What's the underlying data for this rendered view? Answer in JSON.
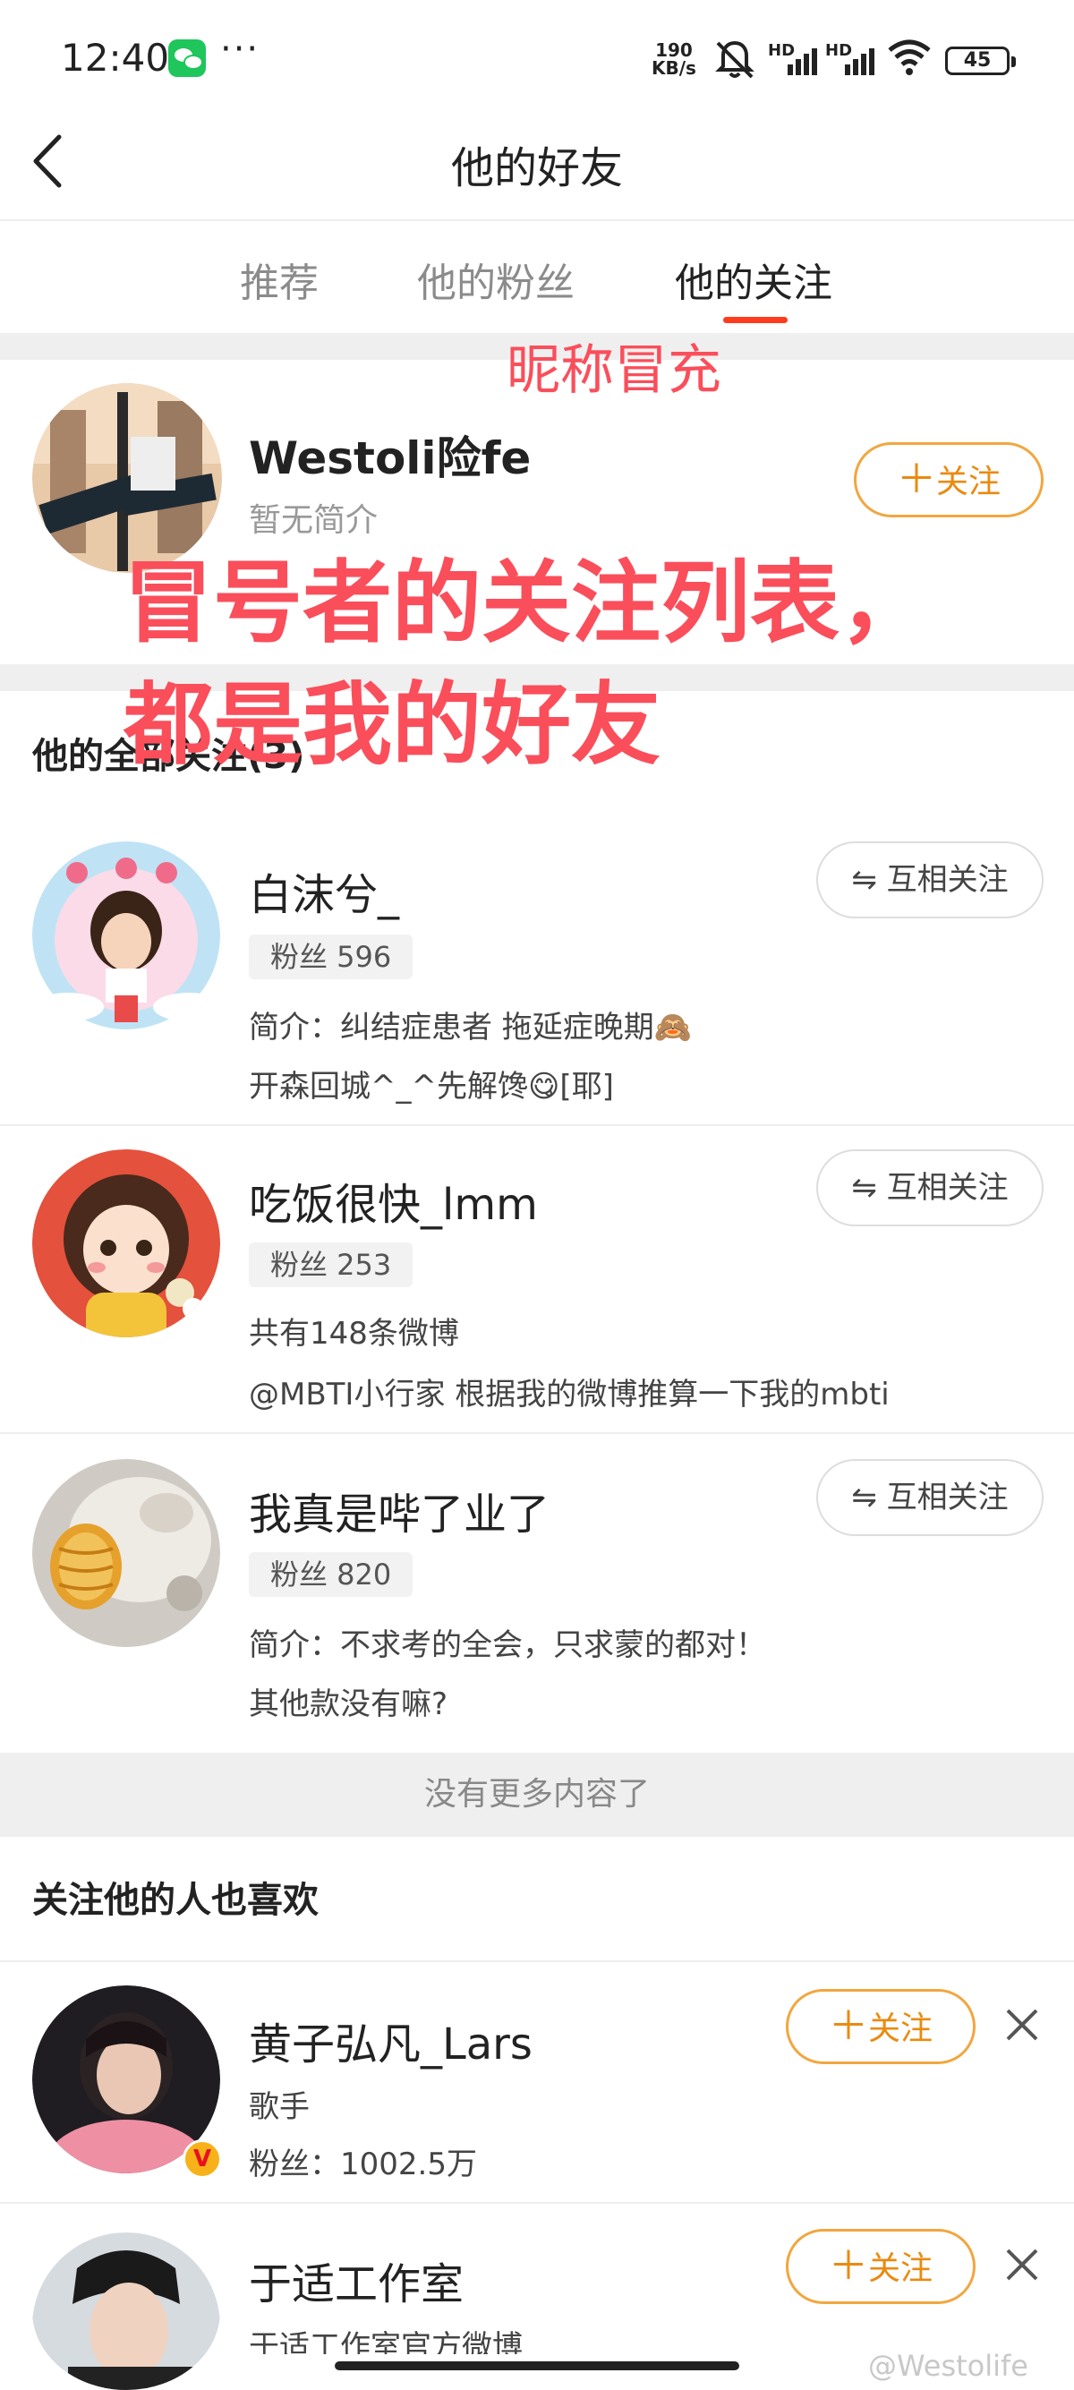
{
  "status_bar": {
    "time": "12:40",
    "more": "···",
    "net_speed_value": "190",
    "net_speed_unit": "KB/s",
    "signal_label_1": "HD",
    "signal_label_2": "HD",
    "battery": "45"
  },
  "header": {
    "title": "他的好友"
  },
  "tabs": [
    {
      "label": "推荐",
      "active": false
    },
    {
      "label": "他的粉丝",
      "active": false
    },
    {
      "label": "他的关注",
      "active": true
    }
  ],
  "annotations": {
    "nickname_fake": "昵称冒充",
    "line1": "冒号者的关注列表，",
    "line2": "都是我的好友"
  },
  "profile": {
    "name": "Westoli险fe",
    "bio": "暂无简介",
    "follow_label": "关注"
  },
  "following": {
    "section_title": "他的全部关注(3)",
    "users": [
      {
        "name": "白沫兮_",
        "fans": "粉丝 596",
        "line1": "简介：纠结症患者 拖延症晚期🙈",
        "line2": "开森回城^_^先解馋😋[耶]",
        "button": "互相关注"
      },
      {
        "name": "吃饭很快_lmm",
        "fans": "粉丝 253",
        "line1": "共有148条微博",
        "line2": "@MBTI小行家 根据我的微博推算一下我的mbti",
        "button": "互相关注"
      },
      {
        "name": "我真是哔了业了",
        "fans": "粉丝 820",
        "line1": "简介：不求考的全会，只求蒙的都对！",
        "line2": "其他款没有嘛?",
        "button": "互相关注"
      }
    ],
    "no_more": "没有更多内容了"
  },
  "recommend": {
    "section_title": "关注他的人也喜欢",
    "users": [
      {
        "name": "黄子弘凡_Lars",
        "line1": "歌手",
        "line2": "粉丝：1002.5万",
        "button": "关注",
        "verified_badge": "V"
      },
      {
        "name": "于适工作室",
        "line1": "于适工作室官方微博",
        "button": "关注"
      }
    ]
  },
  "watermark": "@Westolife",
  "colors": {
    "accent_orange": "#ea8a10",
    "tab_underline": "#ff3b1e",
    "annotation_red": "#fa4e5b"
  }
}
